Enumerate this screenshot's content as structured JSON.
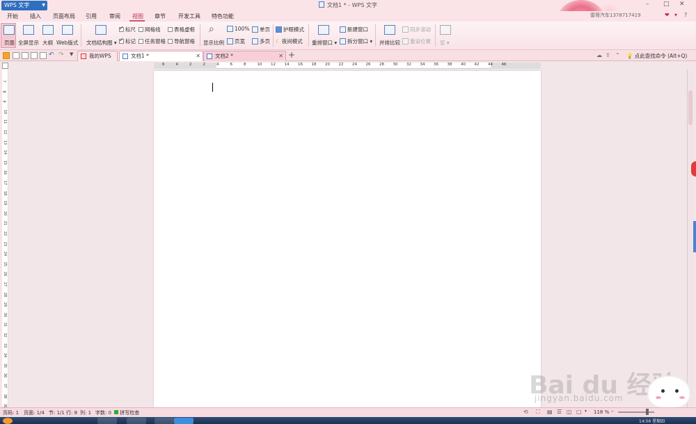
{
  "titlebar": {
    "app_label": "WPS 文字",
    "window_title": "文档1 * - WPS 文字",
    "min": "–",
    "max": "□",
    "close": "✕"
  },
  "menu": {
    "items": [
      "开始",
      "插入",
      "页面布局",
      "引用",
      "审阅",
      "视图",
      "章节",
      "开发工具",
      "特色功能"
    ],
    "active": "视图",
    "user": "雷哥汽车1378717419",
    "help": "?"
  },
  "ribbon": {
    "page_view": "页面",
    "fullscreen": "全屏显示",
    "outline": "大纲",
    "web_layout": "Web版式",
    "doc_structure": "文档结构图",
    "ruler": "标尺",
    "gridlines": "网格线",
    "table_gridlines": "表格虚框",
    "marks": "标记",
    "task_pane": "任务窗格",
    "nav_pane": "导航窗格",
    "zoom": "显示比例",
    "zoom_100": "100%",
    "page_width": "页宽",
    "one_page": "单页",
    "multi_page": "多页",
    "eye_protect": "护眼模式",
    "night_mode": "夜间模式",
    "rearrange": "重排窗口",
    "new_window": "新建窗口",
    "split_window": "拆分窗口",
    "side_by_side": "并排比较",
    "sync_scroll": "同步滚动",
    "reset_pos": "重设位置",
    "macro": "宏"
  },
  "tabs": [
    {
      "label": "我的WPS"
    },
    {
      "label": "文档1 *",
      "close": "✕"
    },
    {
      "label": "文档2 *",
      "close": "✕"
    }
  ],
  "tab_add": "+",
  "search_cmd": "点此查找命令 (Alt+Q)",
  "ruler_h": [
    "6",
    "4",
    "2",
    "2",
    "4",
    "6",
    "8",
    "10",
    "12",
    "14",
    "16",
    "18",
    "20",
    "22",
    "24",
    "26",
    "28",
    "30",
    "32",
    "34",
    "36",
    "38",
    "40",
    "42",
    "44",
    "46"
  ],
  "ruler_v": [
    "7",
    "8",
    "9",
    "10",
    "11",
    "12",
    "13",
    "14",
    "15",
    "16",
    "17",
    "18",
    "19",
    "20",
    "21",
    "22",
    "23",
    "24",
    "25",
    "26",
    "27",
    "28",
    "29",
    "30",
    "31",
    "32",
    "33",
    "34",
    "35",
    "36",
    "37",
    "38",
    "39"
  ],
  "status": {
    "page_no": "页码: 1",
    "page_of": "页面: 1/4",
    "section": "节: 1/1",
    "row": "行: 8",
    "col": "列: 1",
    "words": "字数: 0",
    "spell": "拼写检查",
    "zoom": "118 %"
  },
  "watermark": {
    "logo": "Bai du 经验",
    "url": "jingyan.baidu.com"
  },
  "taskbar": {
    "time": "14:06 星期四"
  }
}
